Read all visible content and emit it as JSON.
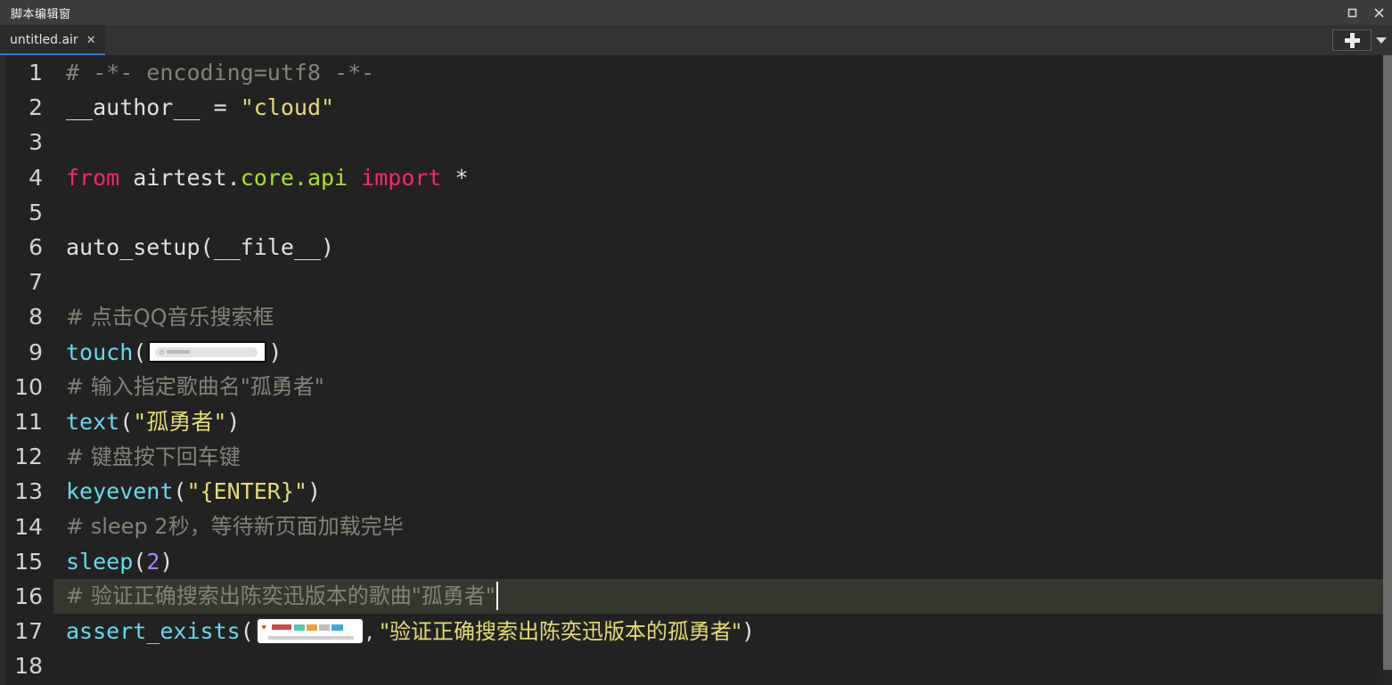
{
  "window": {
    "title": "脚本编辑窗",
    "restore_icon": "restore-icon",
    "close_icon": "close-icon"
  },
  "tabs": {
    "items": [
      {
        "label": "untitled.air",
        "close": "✕",
        "active": true
      }
    ],
    "add_button_label": "+",
    "add_dropdown_icon": "chevron-down-icon"
  },
  "editor": {
    "current_line": 16,
    "total_lines": 18,
    "colors": {
      "background": "#222222",
      "gutter_text": "#d2d2d2",
      "comment": "#808575",
      "keyword": "#f92672",
      "function": "#66d9ef",
      "string": "#e6db74",
      "number": "#ae81ff",
      "member": "#a6e22e",
      "plain": "#d6d6d6",
      "current_line_bg": "#36372f",
      "tab_accent": "#2f7fd0"
    },
    "lines": [
      {
        "n": "1",
        "text": "# -*- encoding=utf8 -*-"
      },
      {
        "n": "2",
        "text": "__author__ = \"cloud\""
      },
      {
        "n": "3",
        "text": ""
      },
      {
        "n": "4",
        "text": "from airtest.core.api import *"
      },
      {
        "n": "5",
        "text": ""
      },
      {
        "n": "6",
        "text": "auto_setup(__file__)"
      },
      {
        "n": "7",
        "text": ""
      },
      {
        "n": "8",
        "text": "# 点击QQ音乐搜索框"
      },
      {
        "n": "9",
        "text": "touch([image])"
      },
      {
        "n": "10",
        "text": "# 输入指定歌曲名\"孤勇者\""
      },
      {
        "n": "11",
        "text": "text(\"孤勇者\")"
      },
      {
        "n": "12",
        "text": "# 键盘按下回车键"
      },
      {
        "n": "13",
        "text": "keyevent(\"{ENTER}\")"
      },
      {
        "n": "14",
        "text": "# sleep 2秒，等待新页面加载完毕"
      },
      {
        "n": "15",
        "text": "sleep(2)"
      },
      {
        "n": "16",
        "text": "# 验证正确搜索出陈奕迅版本的歌曲\"孤勇者\""
      },
      {
        "n": "17",
        "text": "assert_exists([image], \"验证正确搜索出陈奕迅版本的孤勇者\")"
      },
      {
        "n": "18",
        "text": ""
      }
    ],
    "tokens": {
      "l1_comment": "# -*- encoding=utf8 -*-",
      "l2_name": "__author__ ",
      "l2_eq": "= ",
      "l2_str": "\"cloud\"",
      "l4_from": "from",
      "l4_mod_a": " airtest.",
      "l4_mod_b": "core.api",
      "l4_import": " import",
      "l4_star": " *",
      "l6_call": "auto_setup(__file__)",
      "l8_comment": "# 点击QQ音乐搜索框",
      "l9_fn": "touch",
      "l9_open": "(",
      "l9_close": ")",
      "l10_comment": "# 输入指定歌曲名\"孤勇者\"",
      "l11_fn": "text",
      "l11_open": "(",
      "l11_str": "\"孤勇者\"",
      "l11_close": ")",
      "l12_comment": "# 键盘按下回车键",
      "l13_fn": "keyevent",
      "l13_open": "(",
      "l13_str": "\"{ENTER}\"",
      "l13_close": ")",
      "l14_comment": "# sleep 2秒，等待新页面加载完毕",
      "l15_fn": "sleep",
      "l15_open": "(",
      "l15_num": "2",
      "l15_close": ")",
      "l16_comment": "# 验证正确搜索出陈奕迅版本的歌曲\"孤勇者\"",
      "l17_fn": "assert_exists",
      "l17_open": "(",
      "l17_comma": ", ",
      "l17_str": "\"验证正确搜索出陈奕迅版本的孤勇者\"",
      "l17_close": ")"
    },
    "images": {
      "touch_target": "qq-music-search-box-thumbnail",
      "assert_target": "song-result-card-thumbnail"
    }
  },
  "scrollbar": {
    "orientation": "vertical"
  }
}
